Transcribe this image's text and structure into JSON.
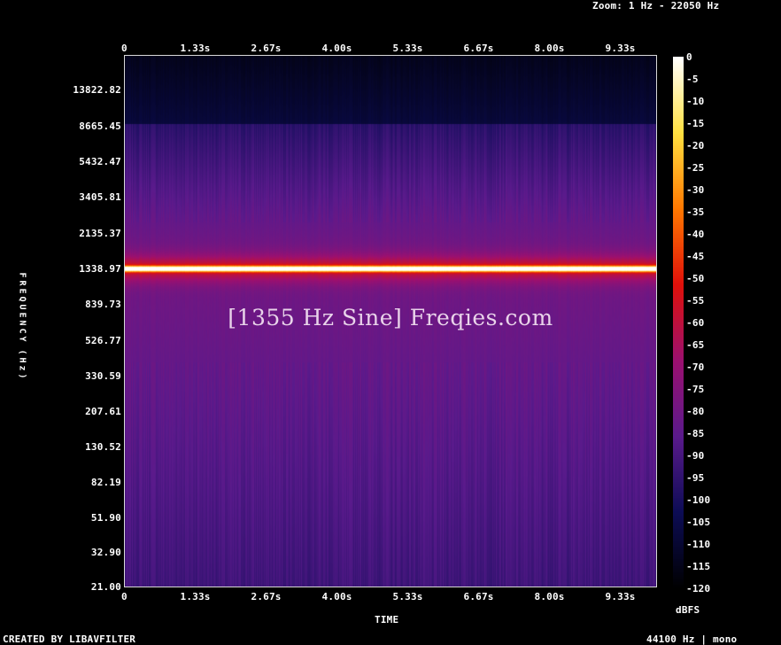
{
  "header": {
    "zoom_text": "Zoom: 1 Hz - 22050 Hz"
  },
  "footer": {
    "created_by": "CREATED BY LIBAVFILTER",
    "sample_info": "44100 Hz | mono"
  },
  "watermark": "[1355 Hz Sine] Freqies.com",
  "chart_data": {
    "type": "heatmap",
    "title": "",
    "xlabel": "TIME",
    "ylabel": "FREQUENCY (Hz)",
    "colorbar_label": "dBFS",
    "x_ticks": [
      "0",
      "1.33s",
      "2.67s",
      "4.00s",
      "5.33s",
      "6.67s",
      "8.00s",
      "9.33s"
    ],
    "y_ticks": [
      "13822.82",
      "8665.45",
      "5432.47",
      "3405.81",
      "2135.37",
      "1338.97",
      "839.73",
      "526.77",
      "330.59",
      "207.61",
      "130.52",
      "82.19",
      "51.90",
      "32.90",
      "21.00"
    ],
    "colorbar_ticks": [
      "0",
      "-5",
      "-10",
      "-15",
      "-20",
      "-25",
      "-30",
      "-35",
      "-40",
      "-45",
      "-50",
      "-55",
      "-60",
      "-65",
      "-70",
      "-75",
      "-80",
      "-85",
      "-90",
      "-95",
      "-100",
      "-105",
      "-110",
      "-115",
      "-120"
    ],
    "xlim": [
      0,
      10.3
    ],
    "ylim": [
      21,
      22050
    ],
    "y_scale": "log",
    "zlim": [
      -120,
      0
    ],
    "tone": {
      "frequency_hz": 1355,
      "level_dbfs": 0
    },
    "colors": {
      "background": "#000000",
      "colormap": [
        "#000000",
        "#0c0c55",
        "#5a1a8c",
        "#9b1070",
        "#e0100a",
        "#ff7800",
        "#ffe040",
        "#ffffff"
      ]
    }
  }
}
